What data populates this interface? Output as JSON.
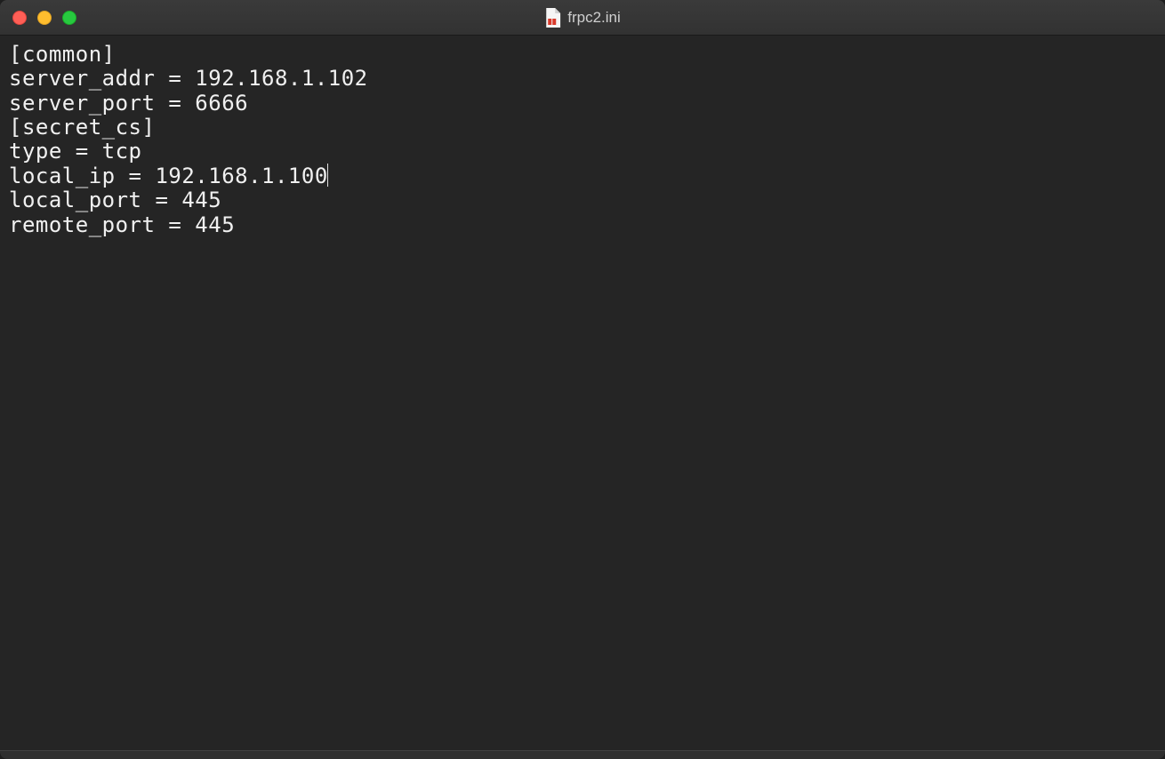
{
  "window": {
    "title": "frpc2.ini"
  },
  "document": {
    "lines": [
      "[common]",
      "server_addr = 192.168.1.102",
      "server_port = 6666",
      "",
      "[secret_cs]",
      "type = tcp",
      "local_ip = 192.168.1.100",
      "local_port = 445",
      "remote_port = 445"
    ],
    "cursor_line_index": 6
  }
}
